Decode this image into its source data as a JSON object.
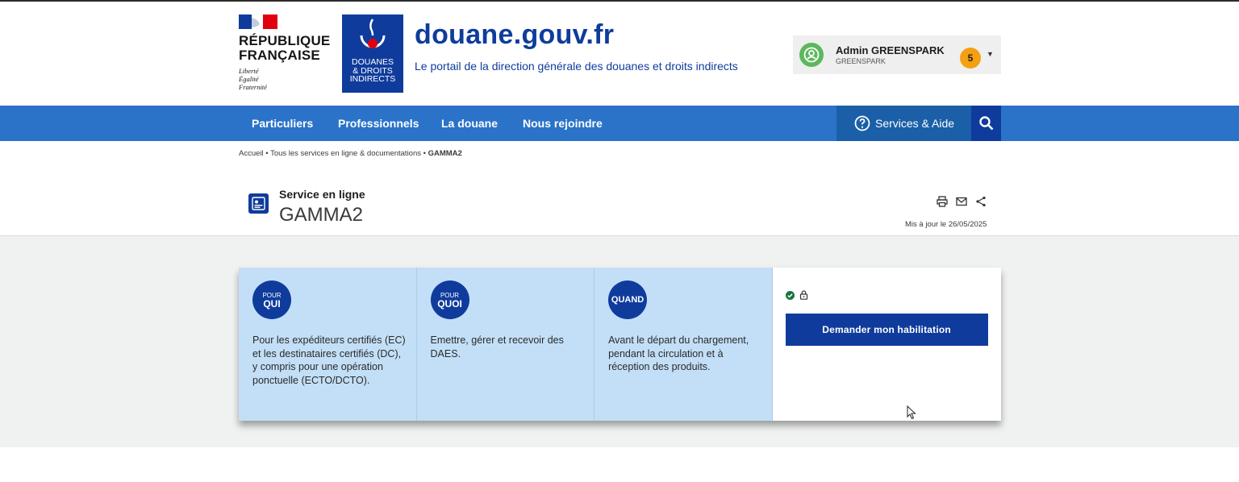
{
  "header": {
    "republic_lines": [
      "RÉPUBLIQUE",
      "FRANÇAISE"
    ],
    "motto_lines": [
      "Liberté",
      "Égalité",
      "Fraternité"
    ],
    "douane_logo_lines": [
      "DOUANES",
      "& DROITS",
      "INDIRECTS"
    ],
    "site_title": "douane.gouv.fr",
    "site_subtitle": "Le portail de la direction générale des douanes et droits indirects",
    "user": {
      "name": "Admin GREENSPARK",
      "organization": "GREENSPARK",
      "notification_count": "5"
    }
  },
  "nav": {
    "items": [
      {
        "label": "Particuliers"
      },
      {
        "label": "Professionnels"
      },
      {
        "label": "La douane"
      },
      {
        "label": "Nous rejoindre"
      }
    ],
    "services_label": "Services & Aide"
  },
  "breadcrumb": {
    "home": "Accueil",
    "section": "Tous les services en ligne & documentations",
    "current": "GAMMA2"
  },
  "service": {
    "kind": "Service en ligne",
    "name": "GAMMA2",
    "updated": "Mis à jour le 26/05/2025"
  },
  "cards": [
    {
      "pill_small": "POUR",
      "pill_big": "QUI",
      "text": "Pour les expéditeurs certifiés (EC) et les destinataires certifiés (DC), y compris pour une opération ponctuelle (ECTO/DCTO)."
    },
    {
      "pill_small": "POUR",
      "pill_big": "QUOI",
      "text": "Emettre, gérer et recevoir des DAES."
    },
    {
      "pill_small": "",
      "pill_big": "QUAND",
      "text": "Avant le départ du chargement, pendant la circulation et à réception des produits."
    }
  ],
  "access": {
    "button_label": "Demander mon habilitation"
  },
  "colors": {
    "brand_blue": "#0f3c9c",
    "nav_blue": "#2a73c9",
    "card_blue": "#c3dff7",
    "badge_orange": "#f5a012"
  }
}
